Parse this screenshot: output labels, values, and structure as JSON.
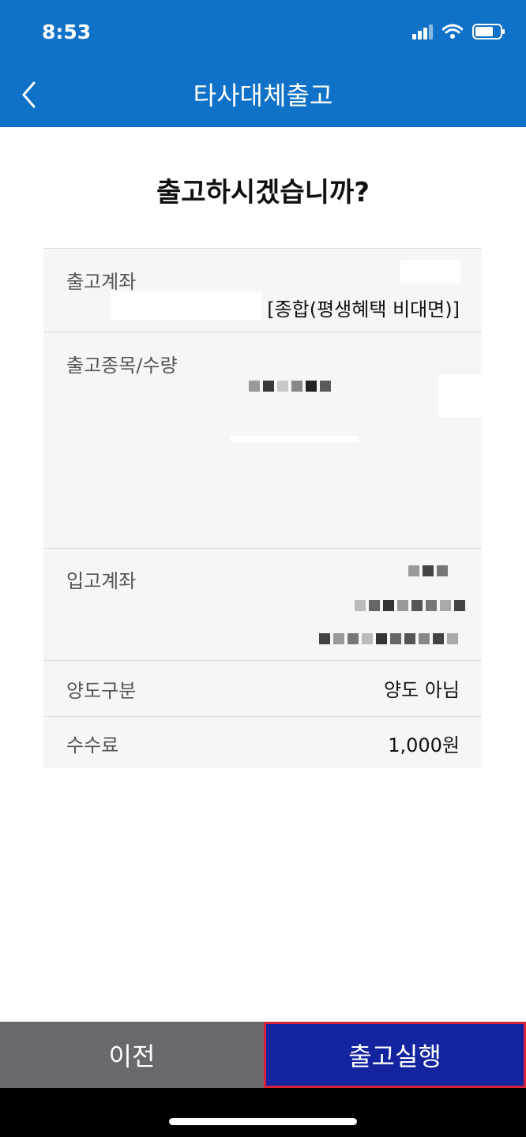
{
  "status": {
    "time": "8:53"
  },
  "header": {
    "title": "타사대체출고"
  },
  "question": "출고하시겠습니까?",
  "rows": {
    "outgoing_account": {
      "label": "출고계좌",
      "account_type": "[종합(평생혜택 비대면)]"
    },
    "outgoing_item": {
      "label": "출고종목/수량"
    },
    "incoming_account": {
      "label": "입고계좌"
    },
    "transfer_type": {
      "label": "양도구분",
      "value": "양도 아님"
    },
    "fee": {
      "label": "수수료",
      "value": "1,000원"
    }
  },
  "buttons": {
    "prev": "이전",
    "execute": "출고실행"
  },
  "icons": {
    "back": "chevron-left-icon",
    "signal": "cellular-signal-icon",
    "wifi": "wifi-icon",
    "battery": "battery-icon"
  },
  "colors": {
    "header": "#0f72c8",
    "prev_button": "#69686d",
    "execute_button": "#14249f",
    "highlight_border": "#d9233b"
  }
}
